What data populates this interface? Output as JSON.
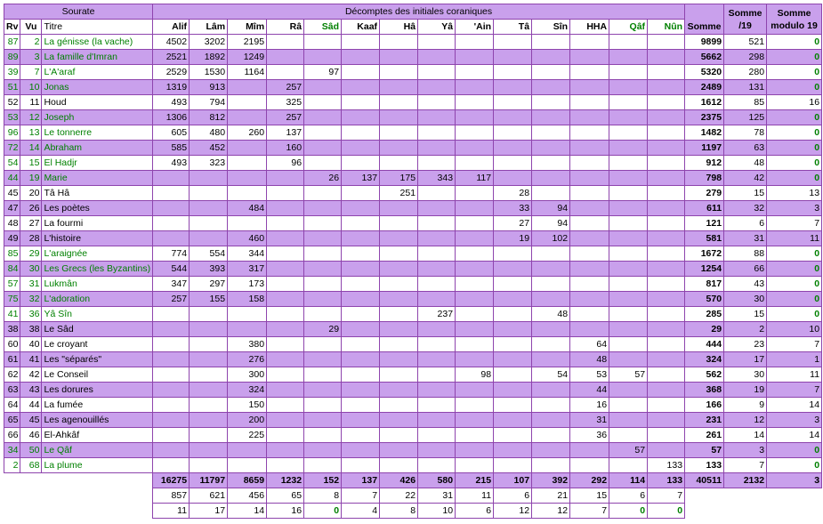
{
  "header": {
    "sourate": "Sourate",
    "decomptes": "Décomptes des initiales coraniques",
    "somme": "Somme",
    "somme19": "Somme /19",
    "somme_mod": "Somme modulo 19",
    "rv": "Rv",
    "vu": "Vu",
    "titre": "Titre",
    "letters": [
      "Alif",
      "Lâm",
      "Mîm",
      "Râ",
      "Sâd",
      "Kaaf",
      "Hâ",
      "Yâ",
      "'Ain",
      "Tâ",
      "Sîn",
      "HHA",
      "Qâf",
      "Nûn"
    ]
  },
  "rows": [
    {
      "rv": "87",
      "vu": "2",
      "titre": "La génisse (la vache)",
      "v": [
        "4502",
        "3202",
        "2195",
        "",
        "",
        "",
        "",
        "",
        "",
        "",
        "",
        "",
        "",
        ""
      ],
      "somme": "9899",
      "s19": "521",
      "mod": "0",
      "hl": false
    },
    {
      "rv": "89",
      "vu": "3",
      "titre": "La famille d'Imran",
      "v": [
        "2521",
        "1892",
        "1249",
        "",
        "",
        "",
        "",
        "",
        "",
        "",
        "",
        "",
        "",
        ""
      ],
      "somme": "5662",
      "s19": "298",
      "mod": "0",
      "hl": true
    },
    {
      "rv": "39",
      "vu": "7",
      "titre": "L'A'araf",
      "v": [
        "2529",
        "1530",
        "1164",
        "",
        "97",
        "",
        "",
        "",
        "",
        "",
        "",
        "",
        "",
        ""
      ],
      "somme": "5320",
      "s19": "280",
      "mod": "0",
      "hl": false
    },
    {
      "rv": "51",
      "vu": "10",
      "titre": "Jonas",
      "v": [
        "1319",
        "913",
        "",
        "257",
        "",
        "",
        "",
        "",
        "",
        "",
        "",
        "",
        "",
        ""
      ],
      "somme": "2489",
      "s19": "131",
      "mod": "0",
      "hl": true
    },
    {
      "rv": "52",
      "vu": "11",
      "titre": "Houd",
      "v": [
        "493",
        "794",
        "",
        "325",
        "",
        "",
        "",
        "",
        "",
        "",
        "",
        "",
        "",
        ""
      ],
      "somme": "1612",
      "s19": "85",
      "mod": "16",
      "hl": false
    },
    {
      "rv": "53",
      "vu": "12",
      "titre": "Joseph",
      "v": [
        "1306",
        "812",
        "",
        "257",
        "",
        "",
        "",
        "",
        "",
        "",
        "",
        "",
        "",
        ""
      ],
      "somme": "2375",
      "s19": "125",
      "mod": "0",
      "hl": true
    },
    {
      "rv": "96",
      "vu": "13",
      "titre": "Le tonnerre",
      "v": [
        "605",
        "480",
        "260",
        "137",
        "",
        "",
        "",
        "",
        "",
        "",
        "",
        "",
        "",
        ""
      ],
      "somme": "1482",
      "s19": "78",
      "mod": "0",
      "hl": false
    },
    {
      "rv": "72",
      "vu": "14",
      "titre": "Abraham",
      "v": [
        "585",
        "452",
        "",
        "160",
        "",
        "",
        "",
        "",
        "",
        "",
        "",
        "",
        "",
        ""
      ],
      "somme": "1197",
      "s19": "63",
      "mod": "0",
      "hl": true
    },
    {
      "rv": "54",
      "vu": "15",
      "titre": "El Hadjr",
      "v": [
        "493",
        "323",
        "",
        "96",
        "",
        "",
        "",
        "",
        "",
        "",
        "",
        "",
        "",
        ""
      ],
      "somme": "912",
      "s19": "48",
      "mod": "0",
      "hl": false
    },
    {
      "rv": "44",
      "vu": "19",
      "titre": "Marie",
      "v": [
        "",
        "",
        "",
        "",
        "26",
        "137",
        "175",
        "343",
        "117",
        "",
        "",
        "",
        "",
        ""
      ],
      "somme": "798",
      "s19": "42",
      "mod": "0",
      "hl": true
    },
    {
      "rv": "45",
      "vu": "20",
      "titre": "Tâ Hâ",
      "v": [
        "",
        "",
        "",
        "",
        "",
        "",
        "251",
        "",
        "",
        "28",
        "",
        "",
        "",
        ""
      ],
      "somme": "279",
      "s19": "15",
      "mod": "13",
      "hl": false
    },
    {
      "rv": "47",
      "vu": "26",
      "titre": "Les poètes",
      "v": [
        "",
        "",
        "484",
        "",
        "",
        "",
        "",
        "",
        "",
        "33",
        "94",
        "",
        "",
        ""
      ],
      "somme": "611",
      "s19": "32",
      "mod": "3",
      "hl": true
    },
    {
      "rv": "48",
      "vu": "27",
      "titre": "La fourmi",
      "v": [
        "",
        "",
        "",
        "",
        "",
        "",
        "",
        "",
        "",
        "27",
        "94",
        "",
        "",
        ""
      ],
      "somme": "121",
      "s19": "6",
      "mod": "7",
      "hl": false
    },
    {
      "rv": "49",
      "vu": "28",
      "titre": "L'histoire",
      "v": [
        "",
        "",
        "460",
        "",
        "",
        "",
        "",
        "",
        "",
        "19",
        "102",
        "",
        "",
        ""
      ],
      "somme": "581",
      "s19": "31",
      "mod": "11",
      "hl": true
    },
    {
      "rv": "85",
      "vu": "29",
      "titre": "L'araignée",
      "v": [
        "774",
        "554",
        "344",
        "",
        "",
        "",
        "",
        "",
        "",
        "",
        "",
        "",
        "",
        ""
      ],
      "somme": "1672",
      "s19": "88",
      "mod": "0",
      "hl": false
    },
    {
      "rv": "84",
      "vu": "30",
      "titre": "Les Grecs (les Byzantins)",
      "v": [
        "544",
        "393",
        "317",
        "",
        "",
        "",
        "",
        "",
        "",
        "",
        "",
        "",
        "",
        ""
      ],
      "somme": "1254",
      "s19": "66",
      "mod": "0",
      "hl": true
    },
    {
      "rv": "57",
      "vu": "31",
      "titre": "Lukmân",
      "v": [
        "347",
        "297",
        "173",
        "",
        "",
        "",
        "",
        "",
        "",
        "",
        "",
        "",
        "",
        ""
      ],
      "somme": "817",
      "s19": "43",
      "mod": "0",
      "hl": false
    },
    {
      "rv": "75",
      "vu": "32",
      "titre": "L'adoration",
      "v": [
        "257",
        "155",
        "158",
        "",
        "",
        "",
        "",
        "",
        "",
        "",
        "",
        "",
        "",
        ""
      ],
      "somme": "570",
      "s19": "30",
      "mod": "0",
      "hl": true
    },
    {
      "rv": "41",
      "vu": "36",
      "titre": "Yâ Sîn",
      "v": [
        "",
        "",
        "",
        "",
        "",
        "",
        "",
        "237",
        "",
        "",
        "48",
        "",
        "",
        ""
      ],
      "somme": "285",
      "s19": "15",
      "mod": "0",
      "hl": false
    },
    {
      "rv": "38",
      "vu": "38",
      "titre": "Le Sâd",
      "v": [
        "",
        "",
        "",
        "",
        "29",
        "",
        "",
        "",
        "",
        "",
        "",
        "",
        "",
        ""
      ],
      "somme": "29",
      "s19": "2",
      "mod": "10",
      "hl": true
    },
    {
      "rv": "60",
      "vu": "40",
      "titre": "Le croyant",
      "v": [
        "",
        "",
        "380",
        "",
        "",
        "",
        "",
        "",
        "",
        "",
        "",
        "64",
        "",
        ""
      ],
      "somme": "444",
      "s19": "23",
      "mod": "7",
      "hl": false
    },
    {
      "rv": "61",
      "vu": "41",
      "titre": "Les \"séparés\"",
      "v": [
        "",
        "",
        "276",
        "",
        "",
        "",
        "",
        "",
        "",
        "",
        "",
        "48",
        "",
        ""
      ],
      "somme": "324",
      "s19": "17",
      "mod": "1",
      "hl": true
    },
    {
      "rv": "62",
      "vu": "42",
      "titre": "Le Conseil",
      "v": [
        "",
        "",
        "300",
        "",
        "",
        "",
        "",
        "",
        "98",
        "",
        "54",
        "53",
        "57",
        ""
      ],
      "somme": "562",
      "s19": "30",
      "mod": "11",
      "hl": false
    },
    {
      "rv": "63",
      "vu": "43",
      "titre": "Les dorures",
      "v": [
        "",
        "",
        "324",
        "",
        "",
        "",
        "",
        "",
        "",
        "",
        "",
        "44",
        "",
        ""
      ],
      "somme": "368",
      "s19": "19",
      "mod": "7",
      "hl": true
    },
    {
      "rv": "64",
      "vu": "44",
      "titre": "La fumée",
      "v": [
        "",
        "",
        "150",
        "",
        "",
        "",
        "",
        "",
        "",
        "",
        "",
        "16",
        "",
        ""
      ],
      "somme": "166",
      "s19": "9",
      "mod": "14",
      "hl": false
    },
    {
      "rv": "65",
      "vu": "45",
      "titre": "Les agenouillés",
      "v": [
        "",
        "",
        "200",
        "",
        "",
        "",
        "",
        "",
        "",
        "",
        "",
        "31",
        "",
        ""
      ],
      "somme": "231",
      "s19": "12",
      "mod": "3",
      "hl": true
    },
    {
      "rv": "66",
      "vu": "46",
      "titre": "El-Ahkâf",
      "v": [
        "",
        "",
        "225",
        "",
        "",
        "",
        "",
        "",
        "",
        "",
        "",
        "36",
        "",
        ""
      ],
      "somme": "261",
      "s19": "14",
      "mod": "14",
      "hl": false
    },
    {
      "rv": "34",
      "vu": "50",
      "titre": "Le Qâf",
      "v": [
        "",
        "",
        "",
        "",
        "",
        "",
        "",
        "",
        "",
        "",
        "",
        "",
        "57",
        ""
      ],
      "somme": "57",
      "s19": "3",
      "mod": "0",
      "hl": true
    },
    {
      "rv": "2",
      "vu": "68",
      "titre": "La plume",
      "v": [
        "",
        "",
        "",
        "",
        "",
        "",
        "",
        "",
        "",
        "",
        "",
        "",
        "",
        "133"
      ],
      "somme": "133",
      "s19": "7",
      "mod": "0",
      "hl": false
    }
  ],
  "totals": {
    "v": [
      "16275",
      "11797",
      "8659",
      "1232",
      "152",
      "137",
      "426",
      "580",
      "215",
      "107",
      "392",
      "292",
      "114",
      "133"
    ],
    "somme": "40511",
    "s19": "2132",
    "mod": "3"
  },
  "div19": [
    "857",
    "621",
    "456",
    "65",
    "8",
    "7",
    "22",
    "31",
    "11",
    "6",
    "21",
    "15",
    "6",
    "7"
  ],
  "mod19": [
    "11",
    "17",
    "14",
    "16",
    "0",
    "4",
    "8",
    "10",
    "6",
    "12",
    "12",
    "7",
    "0",
    "0"
  ]
}
